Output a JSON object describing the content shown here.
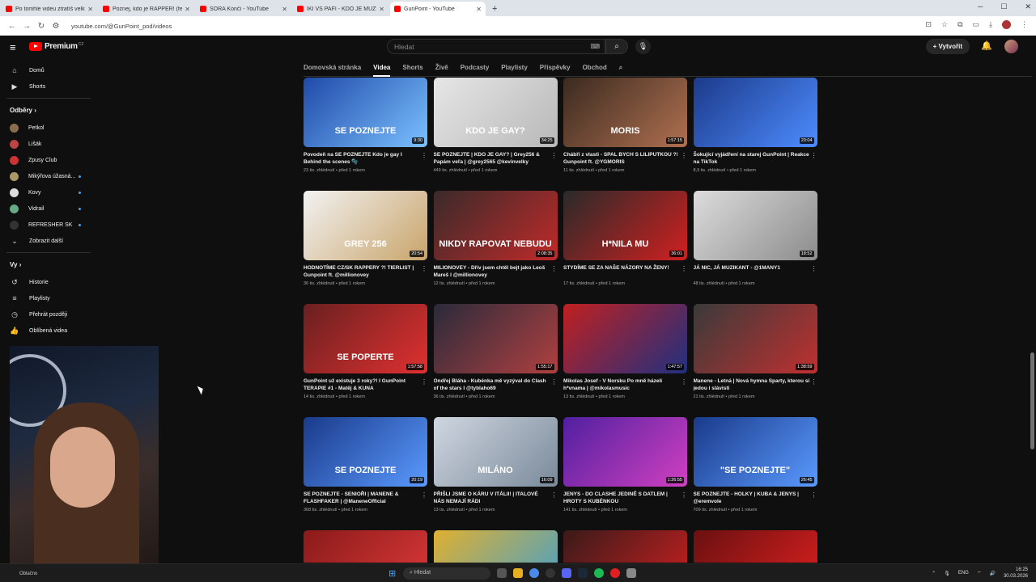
{
  "browser": {
    "tabs": [
      {
        "title": "Po tomhle videu ztratíš velkou",
        "active": false
      },
      {
        "title": "Poznej, kdo je RAPPER! (feat. C",
        "active": false
      },
      {
        "title": "SORA Končí - YouTube",
        "active": false
      },
      {
        "title": "IKI VS PAFI - KDO JE MUŽ? | SE",
        "active": false
      },
      {
        "title": "GunPoint - YouTube",
        "active": true
      }
    ],
    "new_tab": "+",
    "url": "youtube.com/@GunPoint_pod/videos"
  },
  "header": {
    "logo_word": "Premium",
    "logo_region": "CZ",
    "search_placeholder": "Hledat",
    "create_label": "+ Vytvořit"
  },
  "sidebar": {
    "main": [
      {
        "label": "Domů",
        "icon": "home-icon",
        "glyph": "⌂"
      },
      {
        "label": "Shorts",
        "icon": "shorts-icon",
        "glyph": "▶"
      }
    ],
    "subs_heading": "Odběry  ›",
    "subs": [
      {
        "label": "Petkol",
        "color": "#8a6d4f",
        "dot": false
      },
      {
        "label": "Lišák",
        "color": "#b44",
        "dot": false
      },
      {
        "label": "Zpusy Club",
        "color": "#c33",
        "dot": false
      },
      {
        "label": "Mikýřova úžasná...",
        "color": "#a96",
        "dot": true
      },
      {
        "label": "Kovy",
        "color": "#ddd",
        "dot": true
      },
      {
        "label": "Vidrail",
        "color": "#6a8",
        "dot": true
      },
      {
        "label": "REFRESHER SK",
        "color": "#333",
        "dot": true
      }
    ],
    "more": "Zobrazit další",
    "you_heading": "Vy  ›",
    "you": [
      {
        "label": "Historie",
        "icon": "history-icon",
        "glyph": "↺"
      },
      {
        "label": "Playlisty",
        "icon": "playlist-icon",
        "glyph": "≡"
      },
      {
        "label": "Přehrát později",
        "icon": "watch-later-icon",
        "glyph": "◷"
      },
      {
        "label": "Oblíbená videa",
        "icon": "like-icon",
        "glyph": "👍"
      }
    ]
  },
  "channel_tabs": [
    {
      "label": "Domovská stránka",
      "active": false
    },
    {
      "label": "Videa",
      "active": true
    },
    {
      "label": "Shorts",
      "active": false
    },
    {
      "label": "Živě",
      "active": false
    },
    {
      "label": "Podcasty",
      "active": false
    },
    {
      "label": "Playlisty",
      "active": false
    },
    {
      "label": "Příspěvky",
      "active": false
    },
    {
      "label": "Obchod",
      "active": false
    }
  ],
  "videos": [
    {
      "title": "Povodeň na SE POZNEJTE Kdo je gay I Behind the scenes 🫧",
      "meta": "23 tis. zhlédnutí • před 1 rokem",
      "duration": "9:30",
      "thumb_text": "SE POZNEJTE",
      "bg": "linear-gradient(135deg,#1f4aa8,#7bc0ff)"
    },
    {
      "title": "SE POZNEJTE | KDO JE GAY? | Grey256 & Papám veľa | @grey2565 @kevinvelky",
      "meta": "449 tis. zhlédnutí • před 1 rokem",
      "duration": "34:25",
      "thumb_text": "KDO JE GAY?",
      "bg": "linear-gradient(135deg,#e6e6e6,#b8b8b8)"
    },
    {
      "title": "Chábří z vlasti - SPAL BYCH S LILIPUTKOU ?! Gunpoint ft. @YGMORIS",
      "meta": "11 tis. zhlédnutí • před 1 rokem",
      "duration": "1:57:15",
      "thumb_text": "MORIS",
      "bg": "linear-gradient(135deg,#3b2a20,#b07050)"
    },
    {
      "title": "Šokující vyjádření na starej GunPoint | Reakce na TikTok",
      "meta": "8,9 tis. zhlédnutí • před 1 rokem",
      "duration": "20:04",
      "thumb_text": "",
      "bg": "linear-gradient(135deg,#1c3a8a,#4d8cff)"
    },
    {
      "title": "HODNOTÍME CZ/SK RAPPERY ?! TIERLIST | Gunpoint ft. @millionovey",
      "meta": "36 tis. zhlédnutí • před 1 rokem",
      "duration": "20:54",
      "thumb_text": "GREY 256",
      "bg": "linear-gradient(135deg,#f2f2f2,#c9a46a)"
    },
    {
      "title": "MILIONOVEY - Dřív jsem chtěl bejt jako Leoš Mareš I @millionovey",
      "meta": "12 tis. zhlédnutí • před 1 rokem",
      "duration": "2:08:35",
      "thumb_text": "NIKDY RAPOVAT NEBUDU",
      "bg": "linear-gradient(135deg,#3a2a2a,#c02a2a)"
    },
    {
      "title": "STYDÍME SE ZA NAŠE NÁZORY NA ŽENY!",
      "meta": "17 tis. zhlédnutí • před 1 rokem",
      "duration": "36:01",
      "thumb_text": "H*NILA MU",
      "bg": "linear-gradient(135deg,#2a2a2a,#d02020)"
    },
    {
      "title": "JÁ NIC, JÁ MUZIKANT - @1MANY1",
      "meta": "48 tis. zhlédnutí • před 1 rokem",
      "duration": "18:52",
      "thumb_text": "",
      "bg": "linear-gradient(135deg,#dcdcdc,#8c8c8c)"
    },
    {
      "title": "GunPoint už existuje 3 roky?! I GunPoint TERAPIE #1 - Matěj & KUNA",
      "meta": "14 tis. zhlédnutí • před 1 rokem",
      "duration": "1:57:58",
      "thumb_text": "SE POPERTE",
      "bg": "linear-gradient(135deg,#6a2020,#e03030)"
    },
    {
      "title": "Ondřej Bláha - Kubénka mě vyzýval do Clash of the stars I @tyblaho69",
      "meta": "36 tis. zhlédnutí • před 1 rokem",
      "duration": "1:55:17",
      "thumb_text": "",
      "bg": "linear-gradient(135deg,#2a2a3a,#b04040)"
    },
    {
      "title": "Mikolas Josef - V Norsku Po mně házeli h*vnama | @mikolasmusic",
      "meta": "13 tis. zhlédnutí • před 1 rokem",
      "duration": "1:47:57",
      "thumb_text": "",
      "bg": "linear-gradient(135deg,#c02020,#203080)"
    },
    {
      "title": "Manene - Letná | Nová hymna Sparty, kterou si jedou i slávisti",
      "meta": "21 tis. zhlédnutí • před 1 rokem",
      "duration": "1:38:59",
      "thumb_text": "",
      "bg": "linear-gradient(135deg,#3a3a3a,#c03030)"
    },
    {
      "title": "SE POZNEJTE - SENIOŘI | MANENE & FLASHFAKER | @ManeneOfficial",
      "meta": "368 tis. zhlédnutí • před 1 rokem",
      "duration": "20:19",
      "thumb_text": "SE POZNEJTE",
      "bg": "linear-gradient(135deg,#1a3a8a,#5a9aff)"
    },
    {
      "title": "PŘIŠLI JSME O KÁRU V ITÁLII! | ITALOVÉ NÁS NEMAJÍ RÁDI",
      "meta": "13 tis. zhlédnutí • před 1 rokem",
      "duration": "16:09",
      "thumb_text": "MILÁNO",
      "bg": "linear-gradient(135deg,#cfd6e0,#7a8a9a)"
    },
    {
      "title": "JENYS - DO CLASHE JEDINĚ S DATLEM | HROTY S KUBÉNKOU",
      "meta": "141 tis. zhlédnutí • před 1 rokem",
      "duration": "1:26:55",
      "thumb_text": "",
      "bg": "linear-gradient(135deg,#5020a0,#d040c0)"
    },
    {
      "title": "SE POZNEJTE - HOLKY | KUBA & JENYS | @eremvole",
      "meta": "709 tis. zhlédnutí • před 1 rokem",
      "duration": "26:45",
      "thumb_text": "\"SE POZNEJTE\"",
      "bg": "linear-gradient(135deg,#1a3a8a,#5a9aff)"
    },
    {
      "title": "",
      "meta": "",
      "duration": "",
      "thumb_text": "",
      "bg": "linear-gradient(135deg,#8a1a1a,#e03a3a)"
    },
    {
      "title": "",
      "meta": "",
      "duration": "",
      "thumb_text": "",
      "bg": "linear-gradient(135deg,#e0b030,#40a0d0)"
    },
    {
      "title": "",
      "meta": "",
      "duration": "",
      "thumb_text": "",
      "bg": "linear-gradient(135deg,#3a1a1a,#d02020)"
    },
    {
      "title": "",
      "meta": "",
      "duration": "",
      "thumb_text": "",
      "bg": "linear-gradient(135deg,#6a1010,#e02020)"
    }
  ],
  "taskbar": {
    "weather": "Oblačno",
    "search": "Hledat",
    "lang": "ENG",
    "time": "16:25",
    "date": "30.03.2026"
  }
}
